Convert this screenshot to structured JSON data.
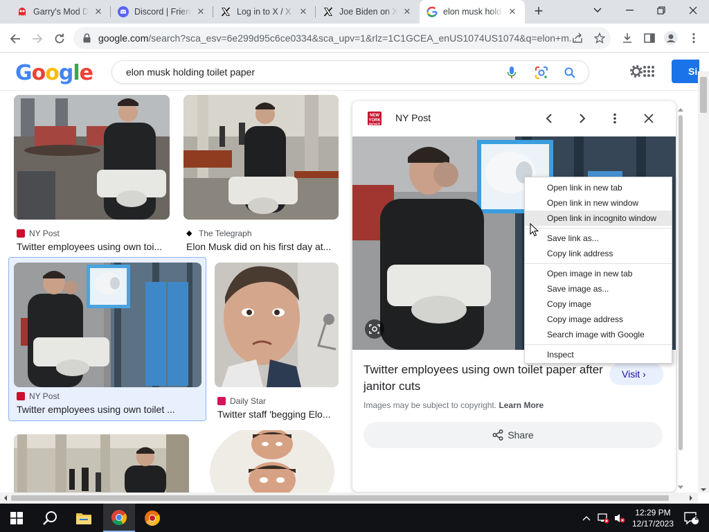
{
  "browser": {
    "tabs": [
      {
        "label": "Garry's Mod Dr...",
        "icon": "garrysmod-icon"
      },
      {
        "label": "Discord | Friends",
        "icon": "discord-icon"
      },
      {
        "label": "Log in to X / X",
        "icon": "x-logo-icon"
      },
      {
        "label": "Joe Biden on X",
        "icon": "x-logo-icon"
      },
      {
        "label": "elon musk holding",
        "icon": "google-g-icon"
      }
    ],
    "url_host": "google.com",
    "url_rest": "/search?sca_esv=6e299d95c6ce0334&sca_upv=1&rlz=1C1GCEA_enUS1074US1074&q=elon+m..."
  },
  "google": {
    "logo_letters": [
      "G",
      "o",
      "o",
      "g",
      "l",
      "e"
    ],
    "logo_colors": [
      "#4285f4",
      "#ea4335",
      "#fbbc05",
      "#4285f4",
      "#34a853",
      "#ea4335"
    ],
    "query": "elon musk holding toilet paper",
    "signin_label": "Si"
  },
  "results": [
    {
      "source": "NY Post",
      "title": "Twitter employees using own toi...",
      "fav_color": "#c8102e"
    },
    {
      "source": "The Telegraph",
      "title": "Elon Musk did on his first day at...",
      "fav_color": "#000000"
    },
    {
      "source": "NY Post",
      "title": "Twitter employees using own toilet ...",
      "fav_color": "#c8102e"
    },
    {
      "source": "Daily Star",
      "title": "Twitter staff 'begging Elo...",
      "fav_color": "#d4145a"
    }
  ],
  "panel": {
    "favicon_text": "NEW YORK POST",
    "source": "NY Post",
    "title": "Twitter employees using own toilet paper after janitor cuts",
    "visit_label": "Visit",
    "copyright": "Images may be subject to copyright.",
    "learn_more": "Learn More",
    "share_label": "Share"
  },
  "context_menu": {
    "group1": [
      "Open link in new tab",
      "Open link in new window",
      "Open link in incognito window"
    ],
    "group2": [
      "Save link as...",
      "Copy link address"
    ],
    "group3": [
      "Open image in new tab",
      "Save image as...",
      "Copy image",
      "Copy image address",
      "Search image with Google"
    ],
    "group4": [
      "Inspect"
    ],
    "highlighted": "Open link in incognito window"
  },
  "taskbar": {
    "time": "12:29 PM",
    "date": "12/17/2023",
    "notification_count": "2"
  }
}
